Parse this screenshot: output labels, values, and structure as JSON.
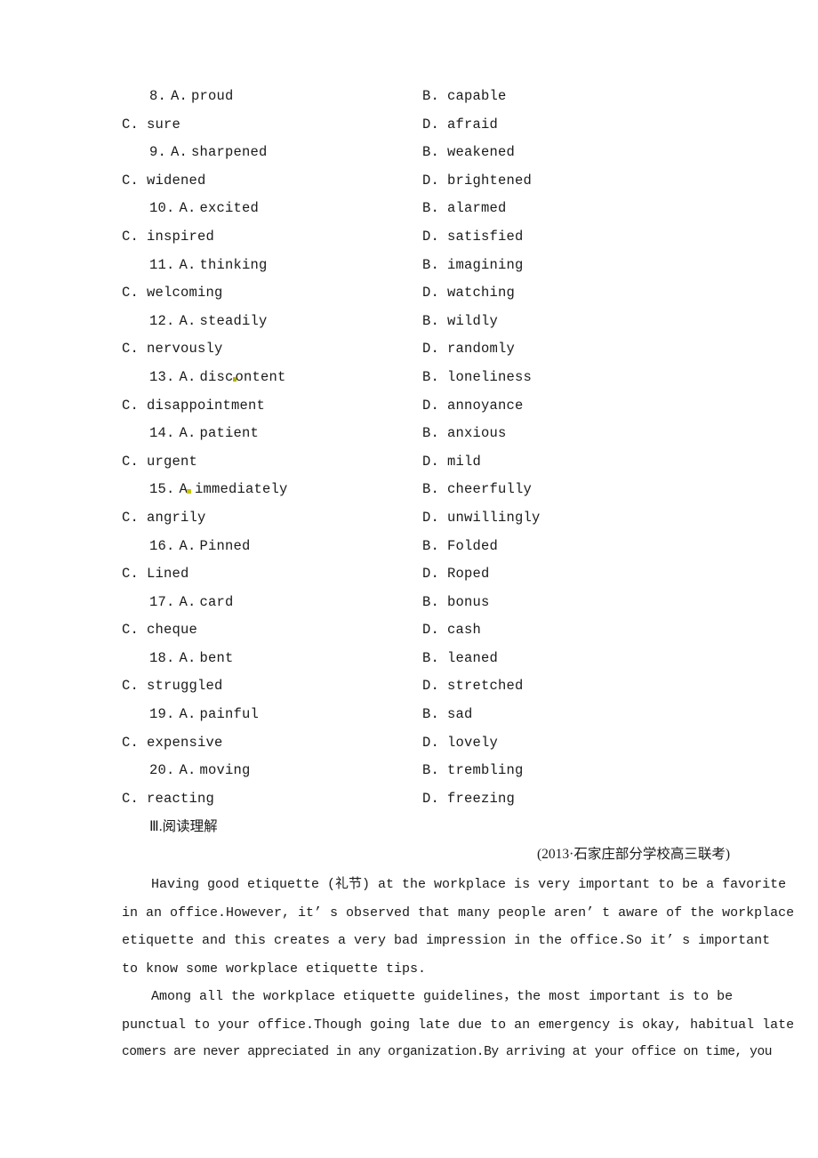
{
  "document": {
    "page_background": "#ffffff",
    "text_color": "#1a1a1a"
  },
  "mcq": {
    "items": [
      {
        "number": "8.",
        "a_letter": "A.",
        "a_text": "proud",
        "b_letter": "B.",
        "b_text": "capable",
        "c_letter": "C.",
        "c_text": "sure",
        "d_letter": "D.",
        "d_text": "afraid"
      },
      {
        "number": "9.",
        "a_letter": "A.",
        "a_text": "sharpened",
        "b_letter": "B.",
        "b_text": "weakened",
        "c_letter": "C.",
        "c_text": "widened",
        "d_letter": "D.",
        "d_text": "brightened"
      },
      {
        "number": "10.",
        "a_letter": "A.",
        "a_text": "excited",
        "b_letter": "B.",
        "b_text": "alarmed",
        "c_letter": "C.",
        "c_text": "inspired",
        "d_letter": "D.",
        "d_text": "satisfied"
      },
      {
        "number": "11.",
        "a_letter": "A.",
        "a_text": "thinking",
        "b_letter": "B.",
        "b_text": "imagining",
        "c_letter": "C.",
        "c_text": "welcoming",
        "d_letter": "D.",
        "d_text": "watching"
      },
      {
        "number": "12.",
        "a_letter": "A.",
        "a_text": "steadily",
        "b_letter": "B.",
        "b_text": "wildly",
        "c_letter": "C.",
        "c_text": "nervously",
        "d_letter": "D.",
        "d_text": "randomly"
      },
      {
        "number": "13.",
        "a_letter": "A.",
        "a_text": "discontent",
        "a_text_pre": "disc",
        "a_text_post": "ontent",
        "b_letter": "B.",
        "b_text": "loneliness",
        "c_letter": "C.",
        "c_text": "disappointment",
        "d_letter": "D.",
        "d_text": "annoyance"
      },
      {
        "number": "14.",
        "a_letter": "A.",
        "a_text": "patient",
        "b_letter": "B.",
        "b_text": "anxious",
        "c_letter": "C.",
        "c_text": "urgent",
        "d_letter": "D.",
        "d_text": "mild"
      },
      {
        "number": "15.",
        "a_letter": "A.",
        "a_text": "immediately",
        "a_letter_mark": "A",
        "b_letter": "B.",
        "b_text": "cheerfully",
        "c_letter": "C.",
        "c_text": "angrily",
        "d_letter": "D.",
        "d_text": "unwillingly"
      },
      {
        "number": "16.",
        "a_letter": "A.",
        "a_text": "Pinned",
        "b_letter": "B.",
        "b_text": "Folded",
        "c_letter": "C.",
        "c_text": "Lined",
        "d_letter": "D.",
        "d_text": "Roped"
      },
      {
        "number": "17.",
        "a_letter": "A.",
        "a_text": "card",
        "b_letter": "B.",
        "b_text": "bonus",
        "c_letter": "C.",
        "c_text": "cheque",
        "d_letter": "D.",
        "d_text": "cash"
      },
      {
        "number": "18.",
        "a_letter": "A.",
        "a_text": "bent",
        "b_letter": "B.",
        "b_text": "leaned",
        "c_letter": "C.",
        "c_text": "struggled",
        "d_letter": "D.",
        "d_text": "stretched"
      },
      {
        "number": "19.",
        "a_letter": "A.",
        "a_text": "painful",
        "b_letter": "B.",
        "b_text": "sad",
        "c_letter": "C.",
        "c_text": "expensive",
        "d_letter": "D.",
        "d_text": "lovely"
      },
      {
        "number": "20.",
        "a_letter": "A.",
        "a_text": "moving",
        "b_letter": "B.",
        "b_text": "trembling",
        "c_letter": "C.",
        "c_text": "reacting",
        "d_letter": "D.",
        "d_text": "freezing"
      }
    ]
  },
  "section": {
    "numeral": "Ⅲ",
    "separator": ".",
    "title": "阅读理解",
    "full": "Ⅲ.阅读理解"
  },
  "source": {
    "text": "(2013·石家庄部分学校高三联考)"
  },
  "passage": {
    "paragraphs": [
      {
        "lines": [
          "Having good etiquette (礼节) at the workplace is very important to be a favorite",
          "in an office.However, it’ s observed that many people aren’ t aware of the workplace",
          "etiquette and this creates a very bad impression in the office.So it’ s important",
          "to know some workplace etiquette tips."
        ]
      },
      {
        "lines": [
          "Among all the workplace etiquette guidelines，the most important is to be",
          "punctual to your office.Though going late due to an emergency is okay, habitual late",
          "comers are never appreciated in any organization.By arriving at your office on time, you"
        ]
      }
    ]
  }
}
